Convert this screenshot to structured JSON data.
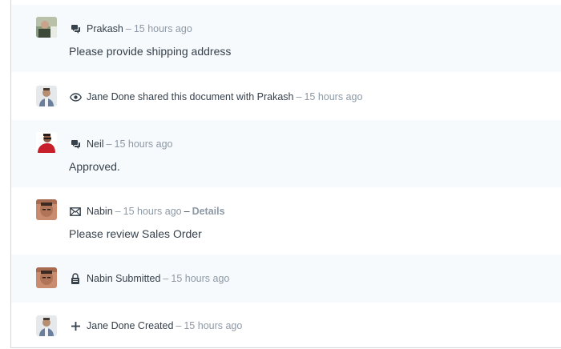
{
  "timeline": {
    "items": [
      {
        "type": "comment",
        "icon": "comment-icon",
        "author": "Prakash",
        "time": "15 hours ago",
        "content": "Please provide shipping address"
      },
      {
        "type": "share",
        "icon": "eye-icon",
        "text": "Jane Done shared this document with Prakash",
        "time": "15 hours ago"
      },
      {
        "type": "comment",
        "icon": "comment-icon",
        "author": "Neil",
        "time": "15 hours ago",
        "content": "Approved."
      },
      {
        "type": "email",
        "icon": "envelope-icon",
        "author": "Nabin",
        "time": "15 hours ago",
        "details_sep": "–",
        "details_label": "Details",
        "content": "Please review Sales Order"
      },
      {
        "type": "submitted",
        "icon": "lock-icon",
        "text": "Nabin Submitted",
        "time": "15 hours ago"
      },
      {
        "type": "created",
        "icon": "plus-icon",
        "text": "Jane Done Created",
        "time": "15 hours ago"
      }
    ],
    "sep": "–",
    "colors": {
      "text": "#36414c",
      "muted": "#8d99a6",
      "shaded_bg": "#f7fafc",
      "border": "#d1d8dd"
    }
  }
}
